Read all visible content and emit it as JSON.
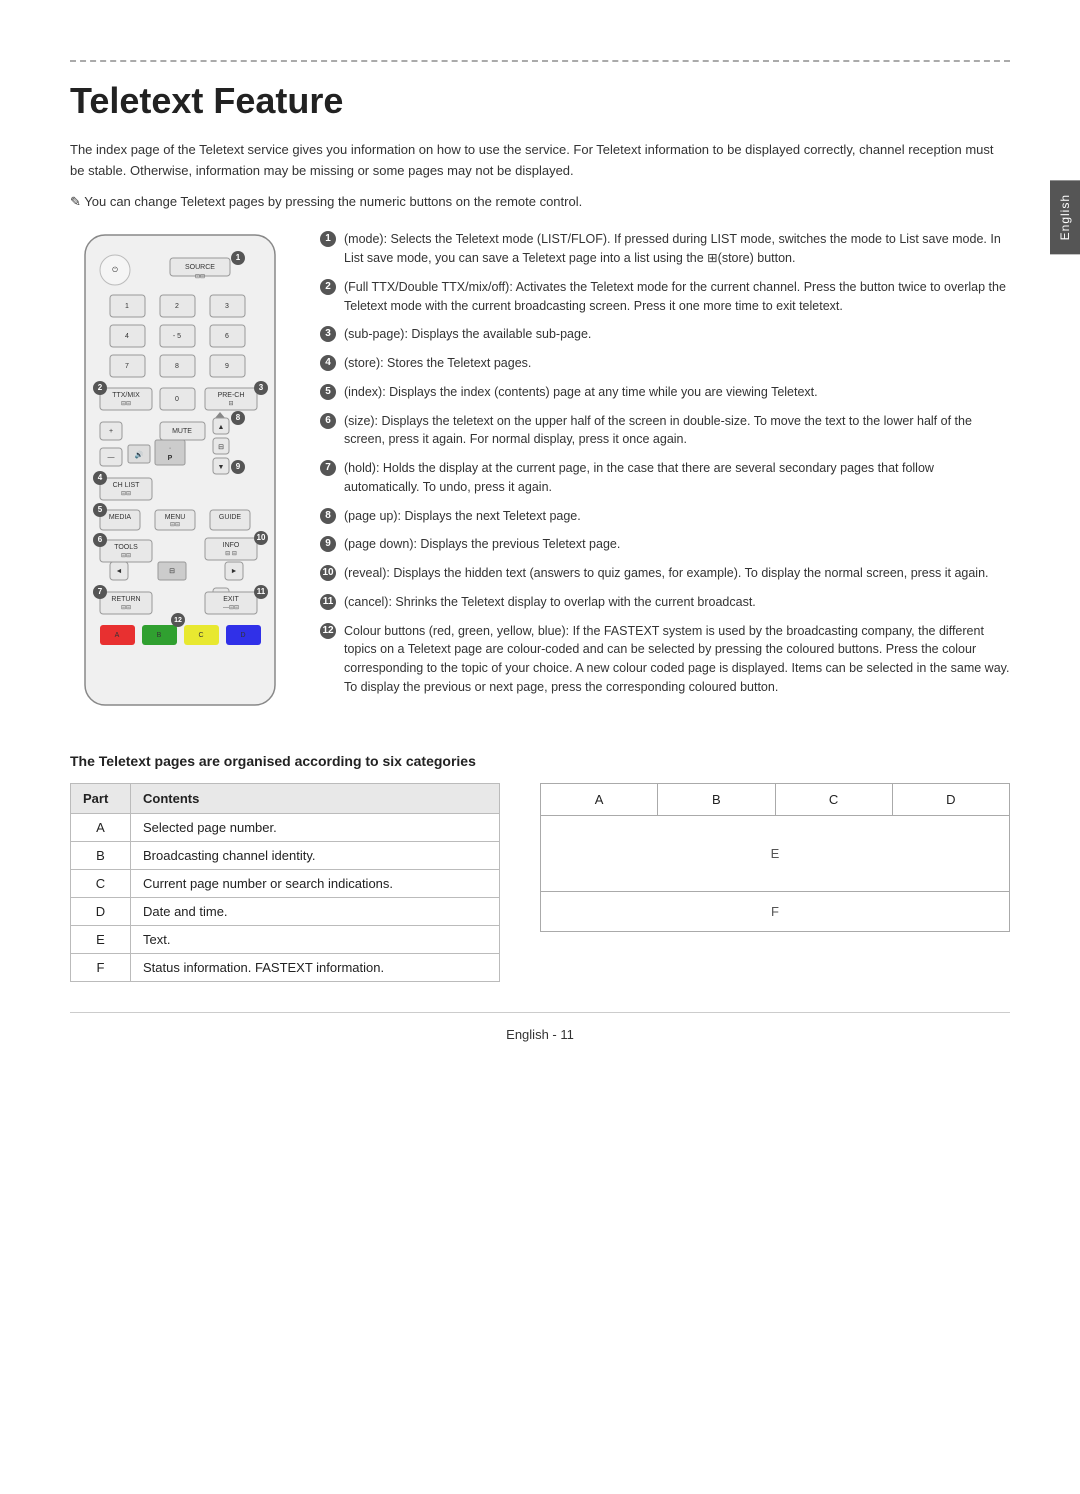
{
  "page": {
    "side_tab": "English",
    "title": "Teletext Feature",
    "intro": "The index page of the Teletext service gives you information on how to use the service. For Teletext information to be displayed correctly, channel reception must be stable. Otherwise, information may be missing or some pages may not be displayed.",
    "note": "You can change Teletext pages by pressing the numeric buttons on the remote control.",
    "features": [
      {
        "num": "1",
        "icon": "≡",
        "text": "(mode): Selects the Teletext mode (LIST/FLOF). If pressed during LIST mode, switches the mode to List save mode. In List save mode, you can save a Teletext page into a list using the ⊞(store) button."
      },
      {
        "num": "2",
        "icon": "⊟⊟",
        "text": "(Full TTX/Double TTX/mix/off): Activates the Teletext mode for the current channel. Press the button twice to overlap the Teletext mode with the current broadcasting screen. Press it one more time to exit teletext."
      },
      {
        "num": "3",
        "icon": "⊟",
        "text": "(sub-page): Displays the available sub-page."
      },
      {
        "num": "4",
        "icon": "⊟",
        "text": "(store): Stores the Teletext pages."
      },
      {
        "num": "5",
        "icon": "⊡",
        "text": "(index): Displays the index (contents) page at any time while you are viewing Teletext."
      },
      {
        "num": "6",
        "icon": "⊞",
        "text": "(size): Displays the teletext on the upper half of the screen in double-size. To move the text to the lower half of the screen, press it again. For normal display, press it once again."
      },
      {
        "num": "7",
        "icon": "⊟",
        "text": "(hold): Holds the display at the current page, in the case that there are several secondary pages that follow automatically. To undo, press it again."
      },
      {
        "num": "8",
        "icon": "⊡",
        "text": "(page up): Displays the next Teletext page."
      },
      {
        "num": "9",
        "icon": "⊟",
        "text": "(page down): Displays the previous Teletext page."
      },
      {
        "num": "10",
        "icon": "⊟",
        "text": "(reveal): Displays the hidden text (answers to quiz games, for example). To display the normal screen, press it again."
      },
      {
        "num": "11",
        "icon": "⊟",
        "text": "(cancel): Shrinks the Teletext display to overlap with the current broadcast."
      },
      {
        "num": "12",
        "icon": "",
        "text": "Colour buttons (red, green, yellow, blue): If the FASTEXT system is used by the broadcasting company, the different topics on a Teletext page are colour-coded and can be selected by pressing the coloured buttons. Press the colour corresponding to the topic of your choice. A new colour coded page is displayed. Items can be selected in the same way. To display the previous or next page, press the corresponding coloured button."
      }
    ],
    "table_section": {
      "title": "The Teletext pages are organised according to six categories",
      "headers": [
        "Part",
        "Contents"
      ],
      "rows": [
        {
          "part": "A",
          "contents": "Selected page number."
        },
        {
          "part": "B",
          "contents": "Broadcasting channel identity."
        },
        {
          "part": "C",
          "contents": "Current page number or search indications."
        },
        {
          "part": "D",
          "contents": "Date and time."
        },
        {
          "part": "E",
          "contents": "Text."
        },
        {
          "part": "F",
          "contents": "Status information. FASTEXT information."
        }
      ],
      "screen_labels": {
        "top_cols": [
          "A",
          "B",
          "C",
          "D"
        ],
        "middle": "E",
        "bottom": "F"
      }
    },
    "footer": "English - 11"
  }
}
